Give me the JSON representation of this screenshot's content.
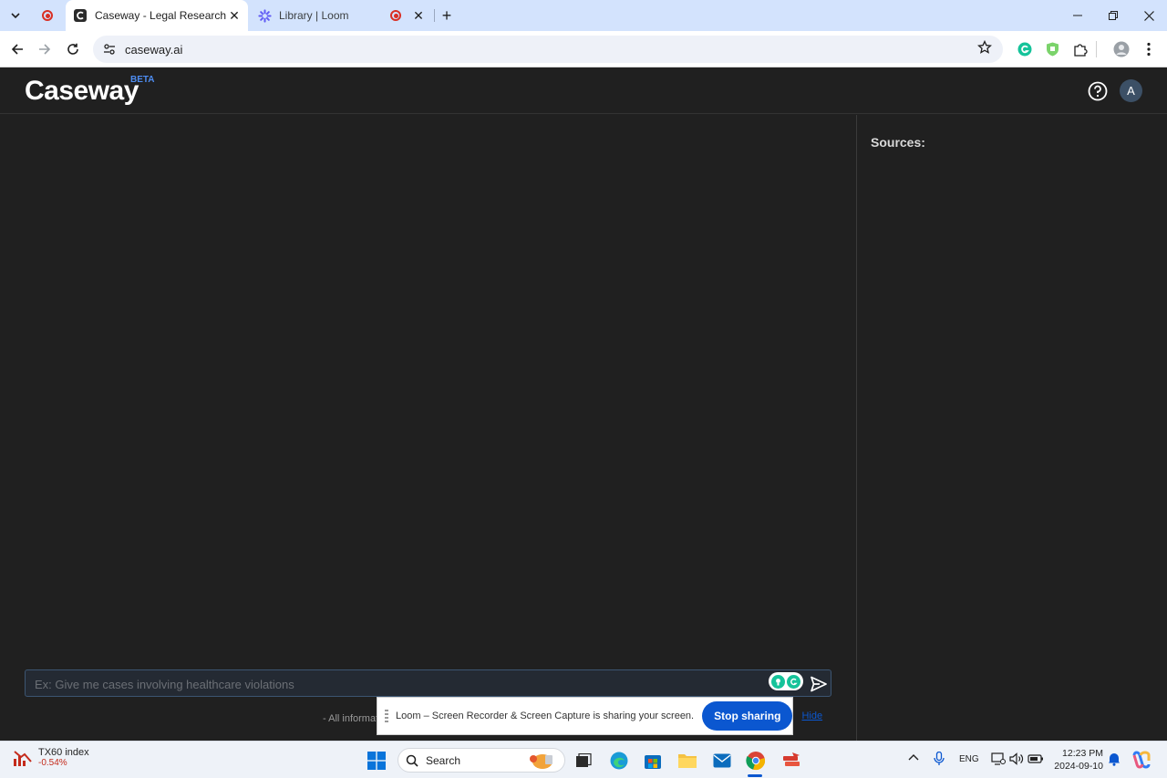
{
  "browser": {
    "tabs": [
      {
        "title": "Caseway - Legal Research AI",
        "active": true
      },
      {
        "title": "Library | Loom",
        "active": false
      }
    ],
    "url": "caseway.ai"
  },
  "app": {
    "logo": "Caseway",
    "beta_badge": "BETA",
    "avatar_initial": "A",
    "sources_title": "Sources:",
    "query_placeholder": "Ex: Give me cases involving healthcare violations",
    "footer_text": "- All informat"
  },
  "loom": {
    "message": "Loom – Screen Recorder & Screen Capture is sharing your screen.",
    "stop_label": "Stop sharing",
    "hide_label": "Hide"
  },
  "taskbar": {
    "widget_title": "TX60 index",
    "widget_change": "-0.54%",
    "search_label": "Search",
    "language": "ENG",
    "time": "12:23 PM",
    "date": "2024-09-10"
  },
  "colors": {
    "app_background": "#202020",
    "accent_blue": "#0b57d0",
    "beta_blue": "#4d8cf0",
    "negative_red": "#c42b1c"
  }
}
